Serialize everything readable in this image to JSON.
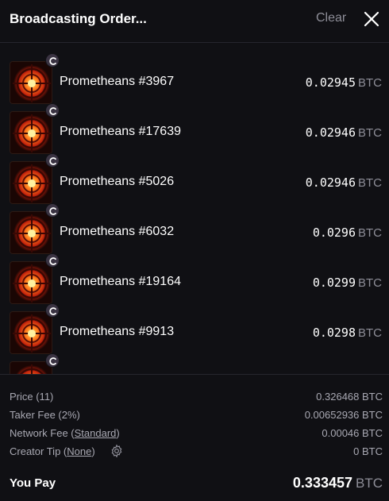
{
  "header": {
    "title": "Broadcasting Order...",
    "clear_label": "Clear"
  },
  "items": [
    {
      "name": "Prometheans #3967",
      "price": "0.02945",
      "unit": "BTC"
    },
    {
      "name": "Prometheans #17639",
      "price": "0.02946",
      "unit": "BTC"
    },
    {
      "name": "Prometheans #5026",
      "price": "0.02946",
      "unit": "BTC"
    },
    {
      "name": "Prometheans #6032",
      "price": "0.0296",
      "unit": "BTC"
    },
    {
      "name": "Prometheans #19164",
      "price": "0.0299",
      "unit": "BTC"
    },
    {
      "name": "Prometheans #9913",
      "price": "0.0298",
      "unit": "BTC"
    },
    {
      "name": "",
      "price": "",
      "unit": ""
    }
  ],
  "summary": {
    "price_label": "Price (11)",
    "price_value": "0.326468 BTC",
    "taker_fee_label": "Taker Fee (2%)",
    "taker_fee_value": "0.00652936 BTC",
    "network_fee_label": "Network Fee (",
    "network_fee_link": "Standard",
    "network_fee_close": ")",
    "network_fee_value": "0.00046 BTC",
    "creator_tip_label": "Creator Tip (",
    "creator_tip_link": "None",
    "creator_tip_close": ")",
    "creator_tip_value": "0 BTC",
    "you_pay_label": "You Pay",
    "you_pay_value": "0.333457",
    "you_pay_unit": "BTC"
  },
  "icons": {
    "close": "close-icon",
    "badge": "collection-c-icon",
    "gear": "gear-icon"
  },
  "colors": {
    "background": "#101014",
    "muted_text": "#8e8e98",
    "badge_bg": "#3a3342"
  }
}
